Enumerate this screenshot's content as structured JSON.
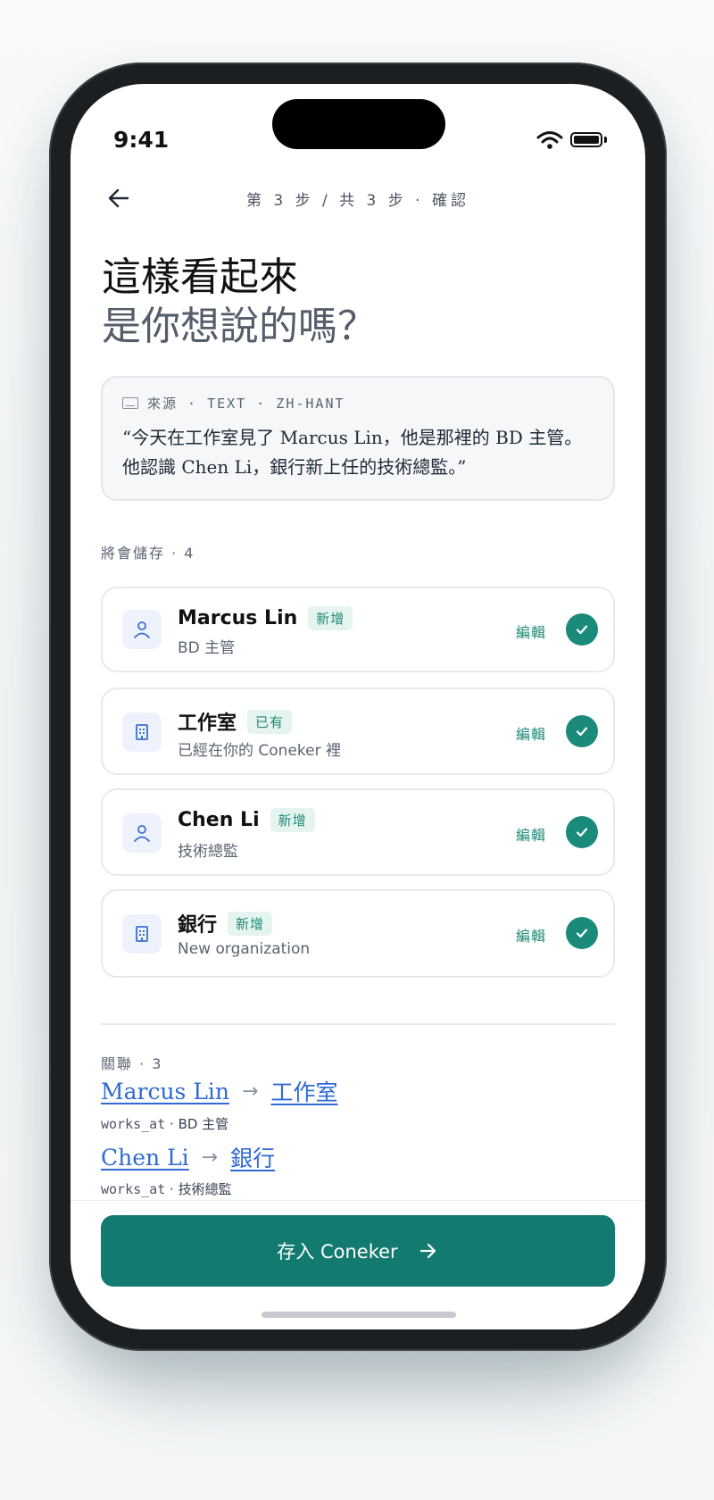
{
  "status": {
    "time": "9:41"
  },
  "header": {
    "step_text": "第 3 步 / 共 3 步 · 確認"
  },
  "title": {
    "line1": "這樣看起來",
    "line2": "是你想說的嗎？"
  },
  "source": {
    "label": "來源 · TEXT · ZH-HANT",
    "text": "“今天在工作室見了 Marcus Lin，他是那裡的 BD 主管。他認識 Chen Li，銀行新上任的技術總監。”"
  },
  "entities_section": {
    "label": "將會儲存 · 4"
  },
  "entities": [
    {
      "name": "Marcus Lin",
      "badge": "新增",
      "subtitle": "BD 主管",
      "icon": "person-icon",
      "edit": "編輯"
    },
    {
      "name": "工作室",
      "badge": "已有",
      "subtitle": "已經在你的 Coneker 裡",
      "icon": "building-icon",
      "edit": "編輯"
    },
    {
      "name": "Chen Li",
      "badge": "新增",
      "subtitle": "技術總監",
      "icon": "person-icon",
      "edit": "編輯"
    },
    {
      "name": "銀行",
      "badge": "新增",
      "subtitle": "New organization",
      "icon": "building-icon",
      "edit": "編輯"
    }
  ],
  "relations_section": {
    "label": "關聯 · 3"
  },
  "relations": [
    {
      "from": "Marcus Lin",
      "to": "工作室",
      "type": "works_at",
      "detail": "BD 主管"
    },
    {
      "from": "Chen Li",
      "to": "銀行",
      "type": "works_at",
      "detail": "技術總監"
    }
  ],
  "cta": {
    "label": "存入 Coneker"
  },
  "colors": {
    "accent": "#127a6e",
    "check": "#1a8a7a",
    "link": "#2f6ad6",
    "badge_bg": "#e6f4f0"
  }
}
